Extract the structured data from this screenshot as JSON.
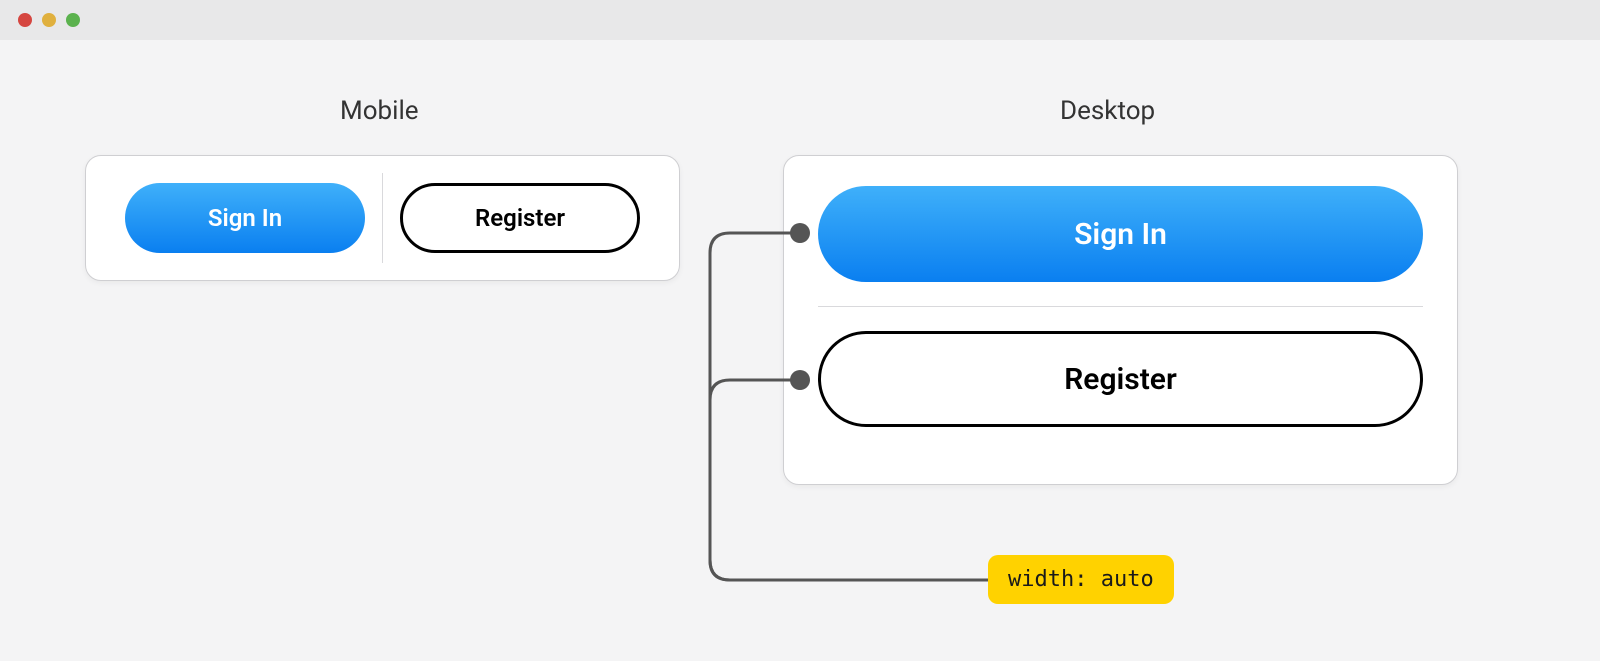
{
  "titlebar": {
    "dot_red": "close",
    "dot_yellow": "minimize",
    "dot_green": "zoom"
  },
  "labels": {
    "mobile": "Mobile",
    "desktop": "Desktop"
  },
  "buttons": {
    "signin": "Sign In",
    "register": "Register"
  },
  "annotation": {
    "width_auto": "width: auto"
  }
}
